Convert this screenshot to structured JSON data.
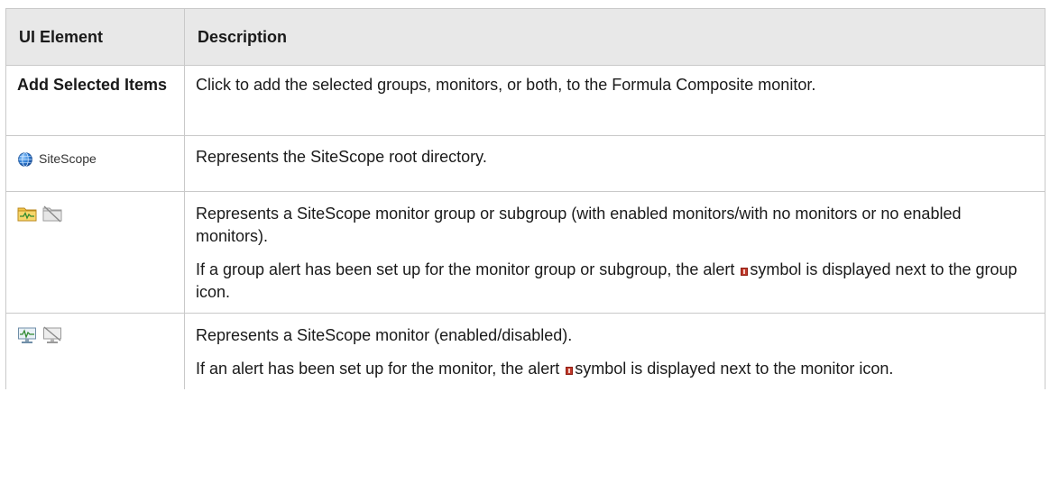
{
  "table": {
    "headers": [
      "UI Element",
      "Description"
    ],
    "rows": {
      "add_selected": {
        "element": "Add Selected Items",
        "description": "Click to add the selected groups, monitors, or both, to the Formula Composite monitor."
      },
      "root": {
        "icon": "globe-icon",
        "label": "SiteScope",
        "description": "Represents the SiteScope root directory."
      },
      "group": {
        "icons": [
          "group-enabled-icon",
          "group-disabled-icon"
        ],
        "description": "Represents a SiteScope monitor group or subgroup (with enabled monitors/with no monitors or no enabled monitors).",
        "alert_before": "If a group alert has been set up for the monitor group or subgroup, the alert",
        "alert_after": "symbol is displayed next to the group icon."
      },
      "monitor": {
        "icons": [
          "monitor-enabled-icon",
          "monitor-disabled-icon"
        ],
        "description": "Represents a SiteScope monitor (enabled/disabled).",
        "alert_before": "If an alert has been set up for the monitor, the alert",
        "alert_after": "symbol is displayed next to the monitor icon."
      }
    }
  }
}
